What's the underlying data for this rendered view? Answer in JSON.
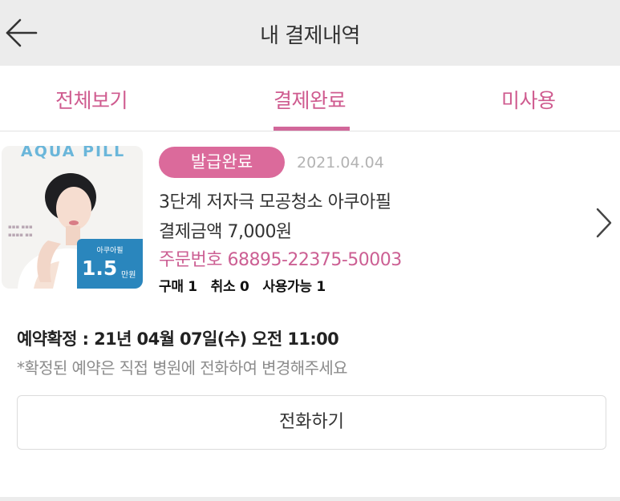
{
  "header": {
    "title": "내 결제내역",
    "back_icon": "arrow-left-icon"
  },
  "tabs": [
    {
      "label": "전체보기",
      "active": false
    },
    {
      "label": "결제완료",
      "active": true
    },
    {
      "label": "미사용",
      "active": false
    }
  ],
  "order": {
    "thumbnail": {
      "brand": "AQUA PILL",
      "badge_label": "아쿠아필",
      "price": "1.5",
      "unit": "만원"
    },
    "status": "발급완료",
    "date": "2021.04.04",
    "product_name": "3단계 저자극 모공청소 아쿠아필",
    "amount": "결제금액 7,000원",
    "order_number": "주문번호 68895-22375-50003",
    "counts": "구매 1   취소 0   사용가능 1",
    "reservation": "예약확정 : 21년 04월 07일(수) 오전 11:00",
    "note": "*확정된 예약은 직접 병원에 전화하여 변경해주세요",
    "call_button": "전화하기"
  },
  "colors": {
    "accent": "#d2679a",
    "header_bg": "#ececec",
    "badge_bg": "#db6a9b",
    "order_number": "#cc5f93"
  }
}
